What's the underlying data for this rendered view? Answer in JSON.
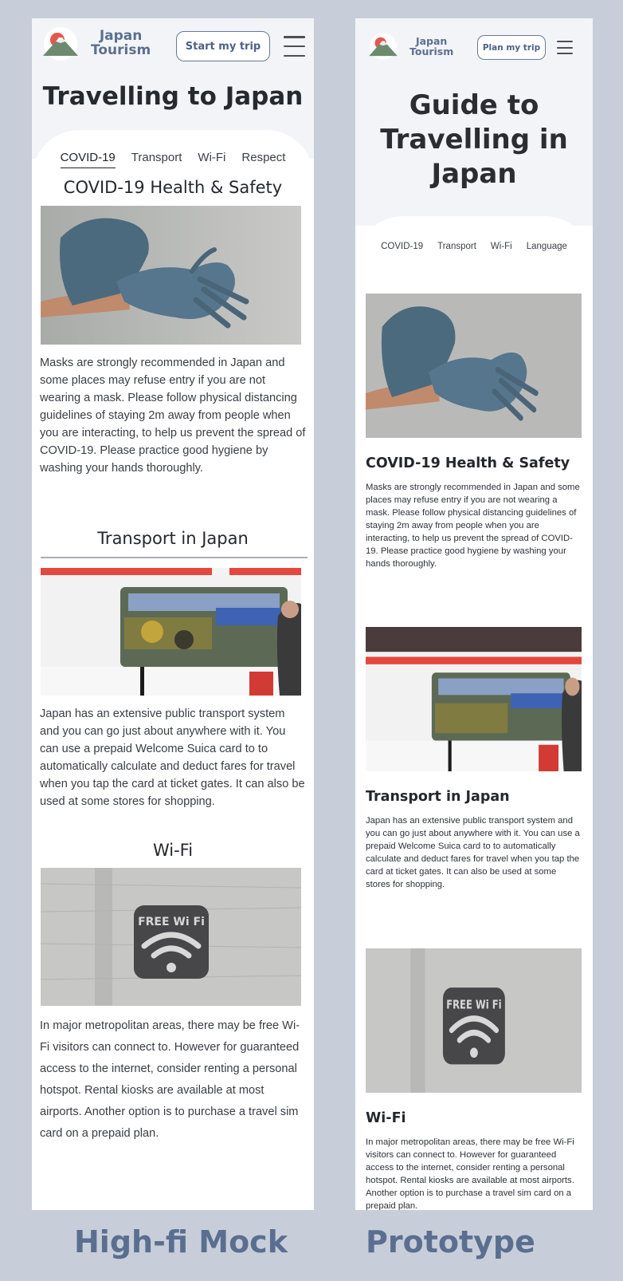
{
  "mock": {
    "brand": [
      "Japan",
      "Tourism"
    ],
    "cta_label": "Start my trip",
    "title": "Travelling to Japan",
    "tabs": [
      "COVID-19",
      "Transport",
      "Wi-Fi",
      "Respect"
    ],
    "active_tab": "COVID-19",
    "sections": [
      {
        "heading": "COVID-19 Health & Safety",
        "image": "gloves-photo",
        "text": "Masks are strongly recommended in Japan and some places may refuse entry if you are not wearing a mask. Please follow physical distancing guidelines of staying 2m away from people when you are interacting, to help us prevent the spread of COVID-19. Please practice good hygiene by washing your hands thoroughly."
      },
      {
        "heading": "Transport in Japan",
        "image": "train-photo",
        "text": "Japan has an extensive public transport system and you can go just about anywhere with it. You can use a prepaid Welcome Suica card to to automatically calculate and deduct fares for travel when you tap the card at ticket gates. It can also be used at some stores for shopping."
      },
      {
        "heading": "Wi-Fi",
        "image": "wifi-photo",
        "text": "In major metropolitan areas, there may be free Wi-Fi visitors can connect to. However for guaranteed access to the internet, consider renting a personal hotspot. Rental kiosks are available at most airports. Another option is to purchase a travel sim card on a prepaid plan."
      }
    ]
  },
  "proto": {
    "brand": [
      "Japan",
      "Tourism"
    ],
    "cta_label": "Plan my trip",
    "title": [
      "Guide to",
      "Travelling in",
      "Japan"
    ],
    "tabs": [
      "COVID-19",
      "Transport",
      "Wi-Fi",
      "Language"
    ],
    "sections": [
      {
        "heading": "COVID-19 Health & Safety",
        "image": "gloves-photo",
        "text": "Masks are strongly recommended in Japan and some places may refuse entry if you are not wearing a mask. Please follow physical distancing guidelines of staying 2m away from people when you are interacting, to help us prevent the spread of COVID-19. Please practice good hygiene by washing your hands thoroughly."
      },
      {
        "heading": "Transport in Japan",
        "image": "train-photo",
        "text": "Japan has an extensive public transport system and you can go just about anywhere with it. You can use a prepaid Welcome Suica card to to automatically calculate and deduct fares for travel when you tap the card at ticket gates. It can also be used at some stores for shopping."
      },
      {
        "heading": "Wi-Fi",
        "image": "wifi-photo",
        "text": "In major metropolitan areas, there may be free Wi-Fi visitors can connect to. However for guaranteed access to the internet, consider renting a personal hotspot. Rental kiosks are available at most airports. Another option is to purchase a travel sim card on a prepaid plan."
      }
    ]
  },
  "wifi_sign_text": "FREE Wi Fi",
  "captions": {
    "left": "High-fi Mock",
    "right": "Prototype"
  },
  "colors": {
    "background": "#c8ced9",
    "accent": "#5b7090",
    "header_bg": "#f3f4f7"
  }
}
